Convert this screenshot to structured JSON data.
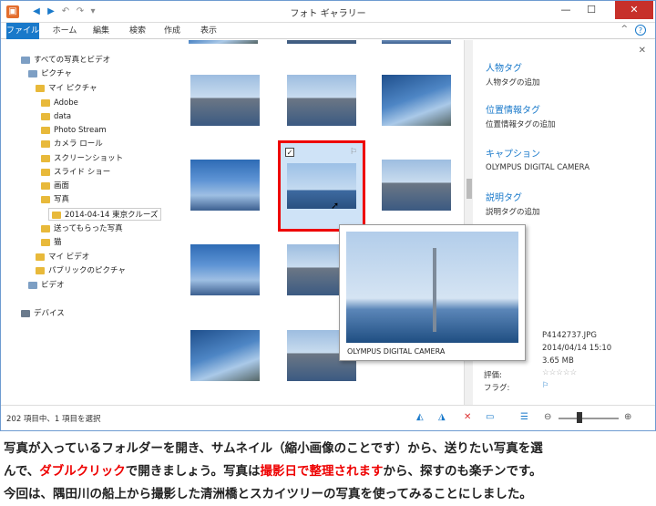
{
  "window": {
    "title": "フォト ギャラリー",
    "min": "—",
    "max": "☐",
    "close": "✕"
  },
  "ribbon": {
    "tabs": [
      "ファイル",
      "ホーム",
      "編集",
      "検索",
      "作成",
      "表示"
    ],
    "help": "?",
    "collapse": "^"
  },
  "nav": {
    "items": [
      {
        "label": "すべての写真とビデオ",
        "icon": "library-icon"
      },
      {
        "label": "ピクチャ",
        "icon": "library-icon"
      },
      {
        "label": "マイ ピクチャ",
        "icon": "folder-icon"
      },
      {
        "label": "Adobe",
        "icon": "folder-icon"
      },
      {
        "label": "data",
        "icon": "folder-icon"
      },
      {
        "label": "Photo Stream",
        "icon": "folder-icon"
      },
      {
        "label": "カメラ ロール",
        "icon": "folder-icon"
      },
      {
        "label": "スクリーンショット",
        "icon": "folder-icon"
      },
      {
        "label": "スライド ショー",
        "icon": "folder-icon"
      },
      {
        "label": "画面",
        "icon": "folder-icon"
      },
      {
        "label": "写真",
        "icon": "folder-icon"
      },
      {
        "label": "2014-04-14 東京クルーズ",
        "icon": "folder-icon"
      },
      {
        "label": "送ってもらった写真",
        "icon": "folder-icon"
      },
      {
        "label": "猫",
        "icon": "folder-icon"
      },
      {
        "label": "マイ ビデオ",
        "icon": "folder-icon"
      },
      {
        "label": "パブリックのピクチャ",
        "icon": "folder-icon"
      },
      {
        "label": "ビデオ",
        "icon": "library-icon"
      },
      {
        "label": "デバイス",
        "icon": "pc-icon"
      }
    ]
  },
  "pane": {
    "people_tag": "人物タグ",
    "people_add": "人物タグの追加",
    "geo_tag": "位置情報タグ",
    "geo_add": "位置情報タグの追加",
    "caption_title": "キャプション",
    "caption_value": "OLYMPUS DIGITAL CAMERA",
    "desc_tag": "説明タグ",
    "desc_add": "説明タグの追加",
    "close": "✕"
  },
  "popup": {
    "caption": "OLYMPUS DIGITAL CAMERA"
  },
  "info": {
    "filename": "P4142737.JPG",
    "datetime": "2014/04/14 15:10",
    "size": "3.65 MB",
    "rating_label": "評価:",
    "rating_stars": "☆☆☆☆☆",
    "flag_label": "フラグ:",
    "flag_icon": "⚐"
  },
  "status": {
    "text": "202 項目中、1 項目を選択"
  },
  "caption": {
    "line1": "写真が入っているフォルダーを開き、サムネイル（縮小画像のことです）から、送りたい写真を選",
    "line2a": "んで、",
    "line2b": "ダブルクリック",
    "line2c": "で開きましょう。写真は",
    "line2d": "撮影日で整理されます",
    "line2e": "から、探すのも楽チンです。",
    "line3": "今回は、隅田川の船上から撮影した清洲橋とスカイツリーの写真を使ってみることにしました。"
  }
}
